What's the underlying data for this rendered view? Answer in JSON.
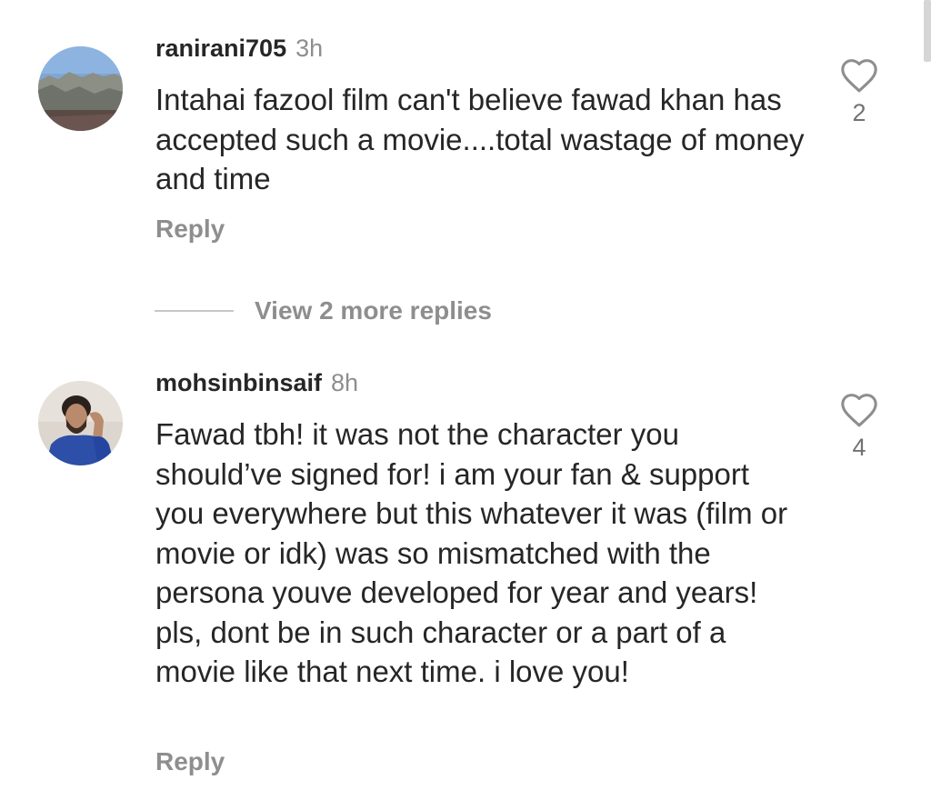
{
  "comments": [
    {
      "username": "ranirani705",
      "time": "3h",
      "text": "Intahai fazool film can't believe fawad khan has accepted such a movie....total wastage of money and time",
      "reply_label": "Reply",
      "likes": "2",
      "avatar_icon": "landscape-avatar"
    },
    {
      "username": "mohsinbinsaif",
      "time": "8h",
      "text": "Fawad tbh! it was not the character you should’ve signed for! i am your fan & support you everywhere but this whatever it was (film or movie or idk) was so mismatched with the persona youve developed for year and years! pls, dont be in such character or a part of a movie like that next time. i love you!",
      "reply_label": "Reply",
      "likes": "4",
      "avatar_icon": "person-avatar"
    }
  ],
  "view_more_replies": "View 2 more replies",
  "colors": {
    "text": "#262626",
    "muted": "#8e8e8e",
    "divider": "#c7c7c7"
  }
}
